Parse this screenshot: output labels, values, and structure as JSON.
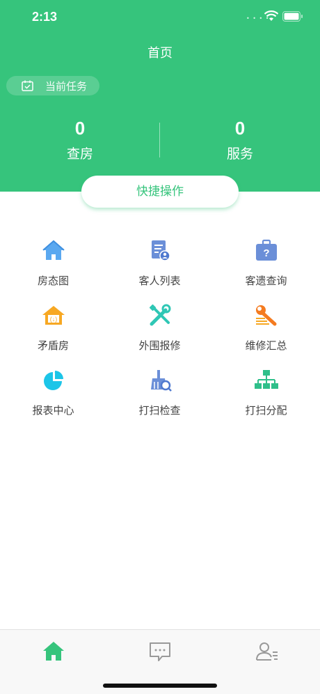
{
  "status_bar": {
    "time": "2:13"
  },
  "header": {
    "title": "首页",
    "task_tag": "当前任务",
    "stats": [
      {
        "value": "0",
        "label": "查房"
      },
      {
        "value": "0",
        "label": "服务"
      }
    ]
  },
  "quick_action": {
    "label": "快捷操作"
  },
  "grid": [
    {
      "label": "房态图",
      "icon": "house-icon"
    },
    {
      "label": "客人列表",
      "icon": "guest-list-icon"
    },
    {
      "label": "客遗查询",
      "icon": "lost-item-icon"
    },
    {
      "label": "矛盾房",
      "icon": "conflict-room-icon"
    },
    {
      "label": "外围报修",
      "icon": "repair-tools-icon"
    },
    {
      "label": "维修汇总",
      "icon": "wrench-summary-icon"
    },
    {
      "label": "报表中心",
      "icon": "pie-chart-icon"
    },
    {
      "label": "打扫检查",
      "icon": "broom-check-icon"
    },
    {
      "label": "打扫分配",
      "icon": "org-chart-icon"
    }
  ],
  "colors": {
    "primary": "#36c47c",
    "icon_blue": "#5aa8f0",
    "icon_orange": "#f7a823",
    "icon_teal": "#2fc7b5",
    "icon_cyan": "#1cc5e8"
  },
  "tabbar": {
    "items": [
      {
        "icon": "home-icon",
        "active": true
      },
      {
        "icon": "message-icon",
        "active": false
      },
      {
        "icon": "profile-icon",
        "active": false
      }
    ]
  }
}
